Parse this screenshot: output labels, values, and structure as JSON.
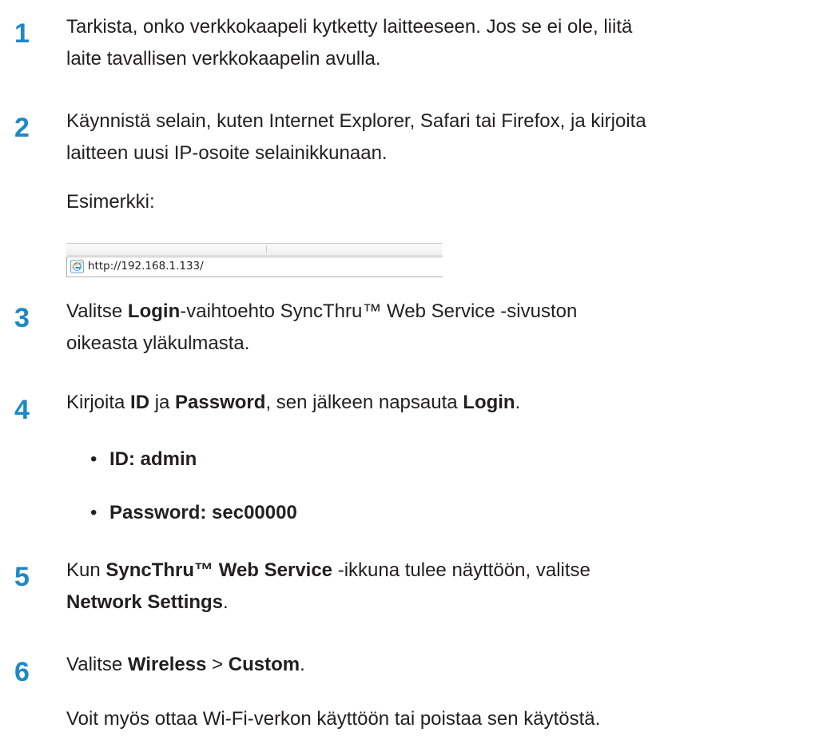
{
  "steps": [
    {
      "number": "1",
      "lines": [
        "Tarkista, onko verkkokaapeli kytketty laitteeseen. Jos se ei ole, liitä",
        "laite tavallisen verkkokaapelin avulla."
      ]
    },
    {
      "number": "2",
      "lines": [
        "Käynnistä selain, kuten Internet Explorer, Safari tai Firefox, ja kirjoita",
        "laitteen uusi IP-osoite selainikkunaan."
      ],
      "example_label": "Esimerkki:"
    },
    {
      "number": "3",
      "segments": {
        "s1": "Valitse ",
        "b1": "Login",
        "s2": "-vaihtoehto SyncThru™ Web Service -sivuston",
        "line2": "oikeasta yläkulmasta."
      }
    },
    {
      "number": "4",
      "segments": {
        "s1": "Kirjoita ",
        "b1": "ID",
        "s2": " ja ",
        "b2": "Password",
        "s3": ", sen jälkeen napsauta ",
        "b3": "Login",
        "s4": "."
      },
      "bullets": [
        "ID: admin",
        "Password: sec00000"
      ],
      "bullet_symbol": "•"
    },
    {
      "number": "5",
      "segments": {
        "s1": "Kun ",
        "b1": "SyncThru™ Web Service",
        "s2": " -ikkuna tulee näyttöön, valitse",
        "b2": "Network Settings",
        "s3": "."
      }
    },
    {
      "number": "6",
      "segments": {
        "s1": "Valitse ",
        "b1": "Wireless",
        "s2": " > ",
        "b2": "Custom",
        "s3": "."
      },
      "note": "Voit myös ottaa Wi-Fi-verkon käyttöön tai poistaa sen käytöstä."
    }
  ],
  "address_bar": {
    "url": "http://192.168.1.133/",
    "icon": "ie-icon"
  },
  "colors": {
    "step_number": "#1e88c8",
    "text": "#231f20"
  }
}
